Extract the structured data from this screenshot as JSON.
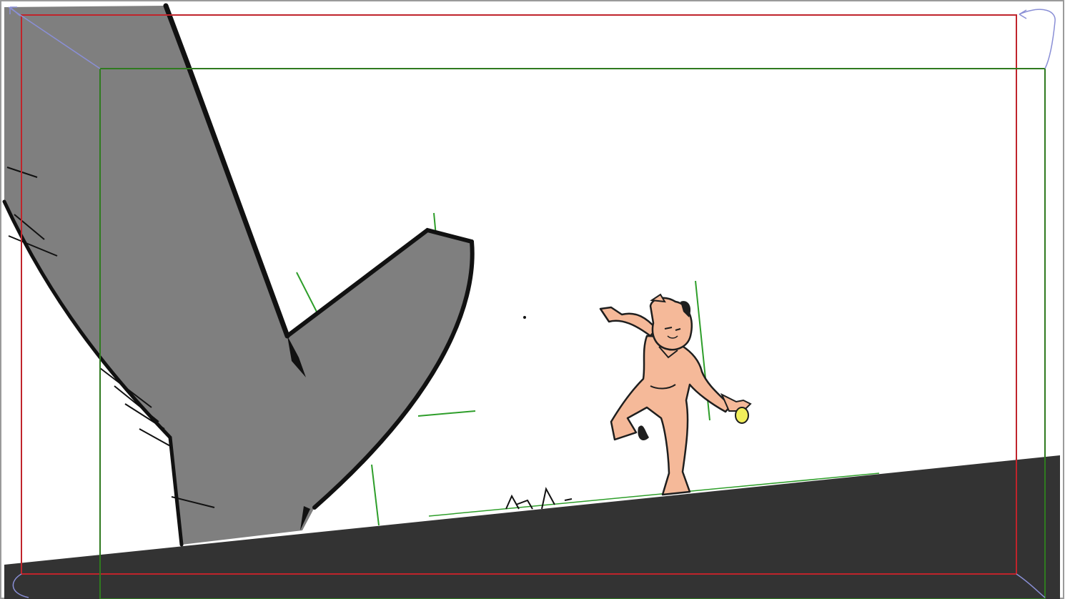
{
  "canvas": {
    "background": "#ffffff",
    "border_color": "#9a9a9a"
  },
  "guides": {
    "outer_frame_color": "#c0242b",
    "inner_frame_color": "#2f7a1f",
    "camera_path_color": "#8a8fd6"
  },
  "scene": {
    "ground_color": "#333333",
    "tree_fill": "#7f7f7f",
    "outline_color": "#111111",
    "skin_color": "#f5b999",
    "ball_color": "#f2ef5a",
    "guide_stroke_color": "#2e9e2a"
  }
}
